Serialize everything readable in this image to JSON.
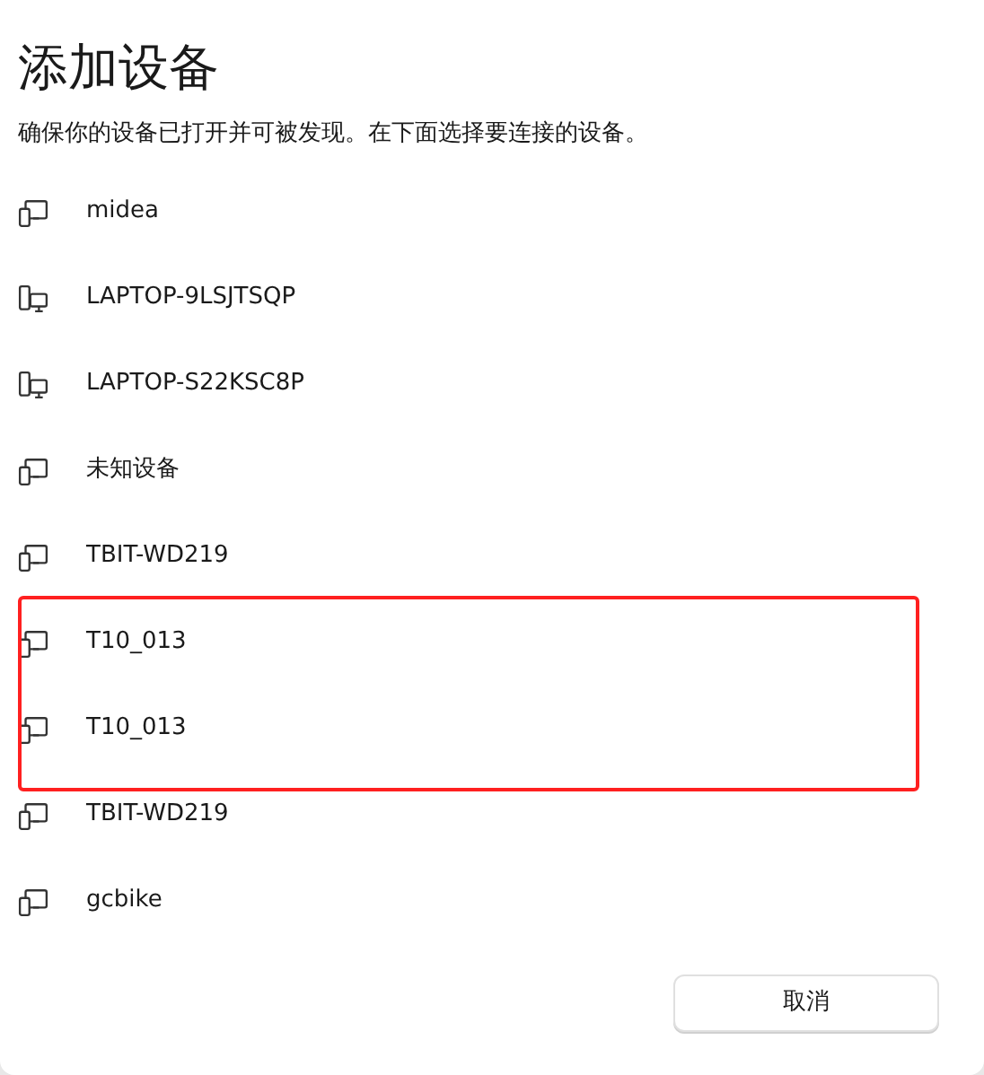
{
  "title": "添加设备",
  "subtitle": "确保你的设备已打开并可被发现。在下面选择要连接的设备。",
  "devices": [
    {
      "name": "midea",
      "kind": "display",
      "highlighted": false
    },
    {
      "name": "LAPTOP-9LSJTSQP",
      "kind": "computer",
      "highlighted": false
    },
    {
      "name": "LAPTOP-S22KSC8P",
      "kind": "computer",
      "highlighted": false
    },
    {
      "name": "未知设备",
      "kind": "display",
      "highlighted": false
    },
    {
      "name": "TBIT-WD219",
      "kind": "display",
      "highlighted": false
    },
    {
      "name": "T10_013",
      "kind": "display",
      "highlighted": true
    },
    {
      "name": "T10_013",
      "kind": "display",
      "highlighted": true
    },
    {
      "name": "TBIT-WD219",
      "kind": "display",
      "highlighted": false
    },
    {
      "name": "gcbike",
      "kind": "display",
      "highlighted": false
    }
  ],
  "cancel_button": "取消"
}
